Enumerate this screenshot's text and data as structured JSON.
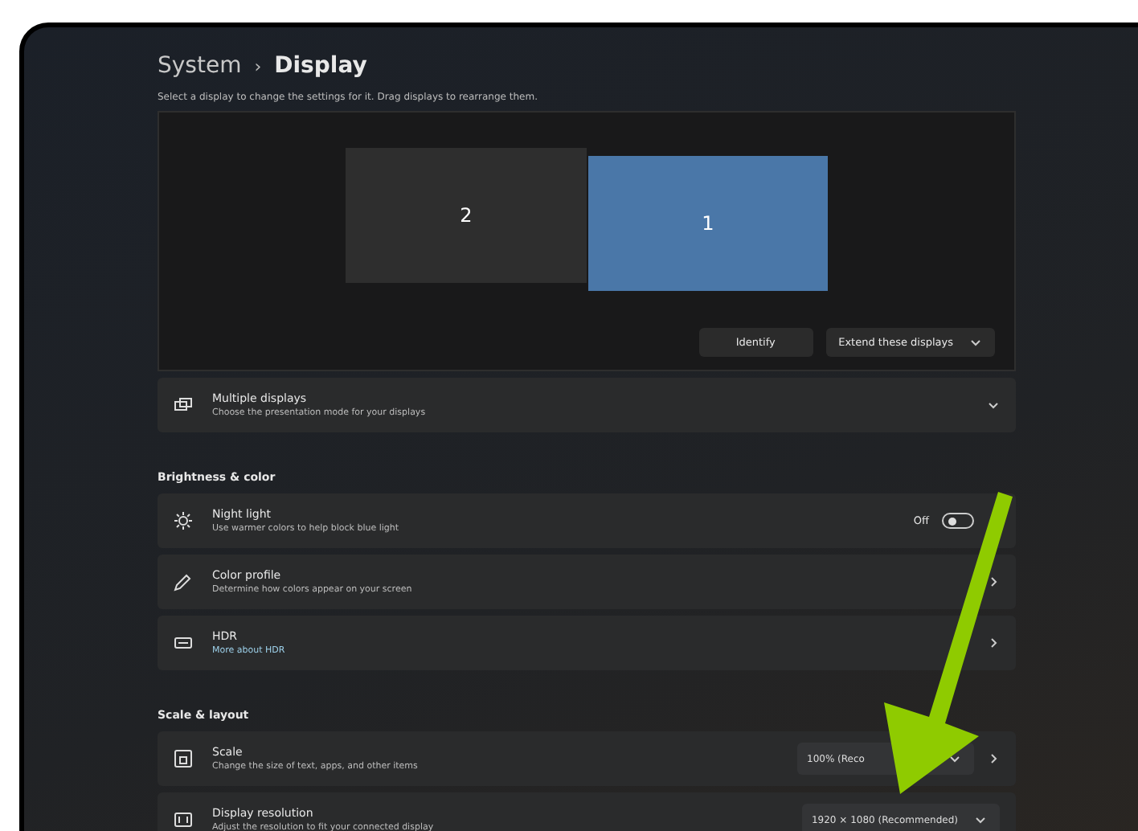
{
  "breadcrumb": {
    "parent": "System",
    "separator": "›",
    "current": "Display"
  },
  "subtitle": "Select a display to change the settings for it. Drag displays to rearrange them.",
  "monitors": [
    {
      "label": "2",
      "selected": false
    },
    {
      "label": "1",
      "selected": true
    }
  ],
  "display_buttons": [
    {
      "label": "Identify",
      "kind": "button"
    },
    {
      "label": "Extend these displays",
      "kind": "dropdown"
    }
  ],
  "sections": [
    {
      "items": [
        {
          "title": "Multiple displays",
          "description": "Choose the presentation mode for your displays",
          "kind": "expander",
          "expanded": false
        }
      ]
    },
    {
      "heading": "Brightness & color",
      "items": [
        {
          "title": "Night light",
          "description": "Use warmer colors to help block blue light",
          "kind": "toggle",
          "toggle_label": "Off",
          "on": false
        },
        {
          "title": "Color profile",
          "description": "Determine how colors appear on your screen",
          "kind": "link"
        },
        {
          "title": "HDR",
          "link": "More about HDR",
          "kind": "link"
        }
      ]
    },
    {
      "heading": "Scale & layout",
      "items": [
        {
          "title": "Scale",
          "description": "Change the size of text, apps, and other items",
          "kind": "choice_link",
          "value": "100% (Reco"
        },
        {
          "title": "Display resolution",
          "description": "Adjust the resolution to fit your connected display",
          "kind": "choice",
          "value": "1920 × 1080 (Recommended)"
        }
      ]
    }
  ]
}
